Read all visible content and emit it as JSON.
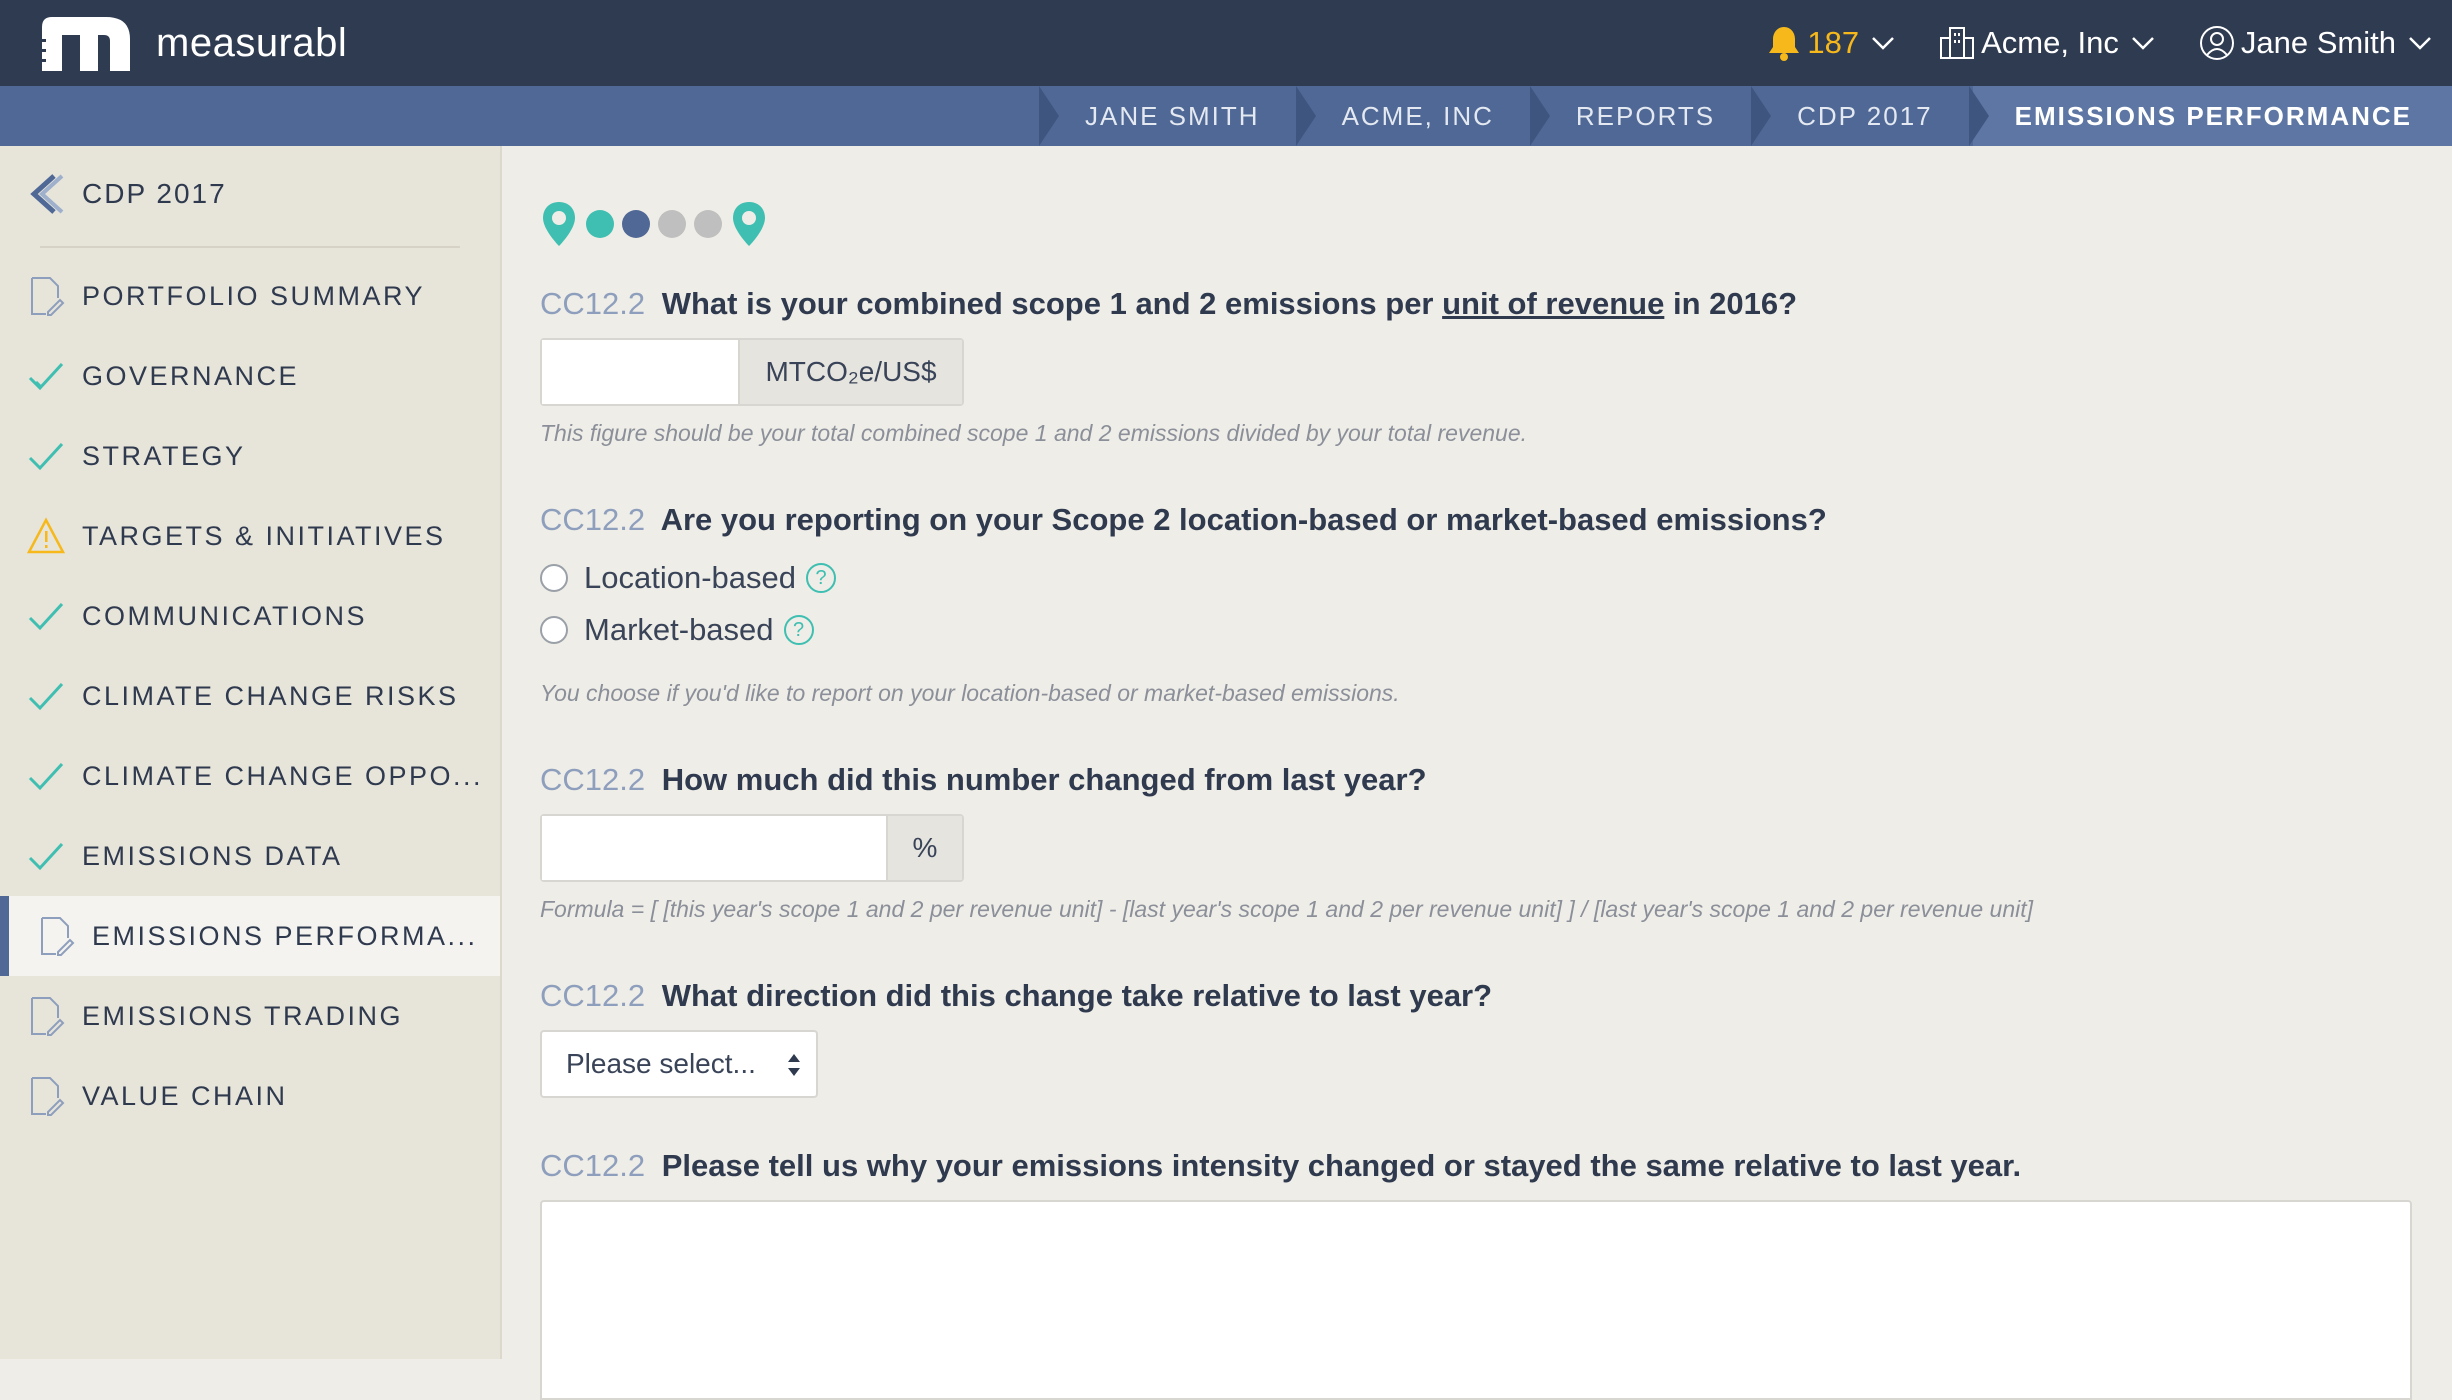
{
  "app": {
    "logo_text": "measurabl"
  },
  "header": {
    "notifications": {
      "count": "187",
      "icon": "bell-icon",
      "color": "#f6b81a"
    },
    "organization": "Acme, Inc",
    "user": "Jane Smith"
  },
  "breadcrumb": [
    "JANE SMITH",
    "ACME, INC",
    "REPORTS",
    "CDP 2017",
    "EMISSIONS PERFORMANCE"
  ],
  "sidebar": {
    "back_label": "CDP 2017",
    "items": [
      {
        "label": "PORTFOLIO SUMMARY",
        "icon": "document-edit-icon",
        "status": "in-progress"
      },
      {
        "label": "GOVERNANCE",
        "icon": "check-icon",
        "status": "complete"
      },
      {
        "label": "STRATEGY",
        "icon": "check-icon",
        "status": "complete"
      },
      {
        "label": "TARGETS & INITIATIVES",
        "icon": "warning-icon",
        "status": "warning"
      },
      {
        "label": "COMMUNICATIONS",
        "icon": "check-icon",
        "status": "complete"
      },
      {
        "label": "CLIMATE CHANGE RISKS",
        "icon": "check-icon",
        "status": "complete"
      },
      {
        "label": "CLIMATE CHANGE OPPO...",
        "icon": "check-icon",
        "status": "complete"
      },
      {
        "label": "EMISSIONS DATA",
        "icon": "check-icon",
        "status": "complete"
      },
      {
        "label": "EMISSIONS PERFORMA...",
        "icon": "document-edit-icon",
        "status": "active"
      },
      {
        "label": "EMISSIONS TRADING",
        "icon": "document-edit-icon",
        "status": "in-progress"
      },
      {
        "label": "VALUE CHAIN",
        "icon": "document-edit-icon",
        "status": "in-progress"
      }
    ]
  },
  "progress": {
    "steps_total": 4,
    "current_step": 2,
    "colors": {
      "done": "#3ebfb1",
      "current": "#4f6895",
      "todo": "#bfbfbf"
    }
  },
  "questions": {
    "q1": {
      "code": "CC12.2",
      "text_before": "What is your combined scope 1 and 2 emissions per",
      "link": "unit of revenue",
      "text_after": "in 2016?",
      "value": "",
      "unit": "MTCO₂e/US$",
      "hint": "This figure should be your total combined scope 1 and 2 emissions divided by your total revenue."
    },
    "q2": {
      "code": "CC12.2",
      "text": "Are you reporting on your Scope 2 location-based or market-based emissions?",
      "options": [
        "Location-based",
        "Market-based"
      ],
      "hint": "You choose if you'd like to report on your location-based or market-based emissions."
    },
    "q3": {
      "code": "CC12.2",
      "text": "How much did this number changed from last year?",
      "value": "",
      "unit": "%",
      "hint": "Formula = [ [this year's scope 1 and 2 per revenue unit] - [last year's scope 1 and 2 per revenue unit] ] / [last year's scope 1 and 2 per revenue unit]"
    },
    "q4": {
      "code": "CC12.2",
      "text": "What direction did this change take relative to last year?",
      "selected": "Please select..."
    },
    "q5": {
      "code": "CC12.2",
      "text": "Please tell us why your emissions intensity changed or stayed the same relative to last year.",
      "value": ""
    }
  }
}
